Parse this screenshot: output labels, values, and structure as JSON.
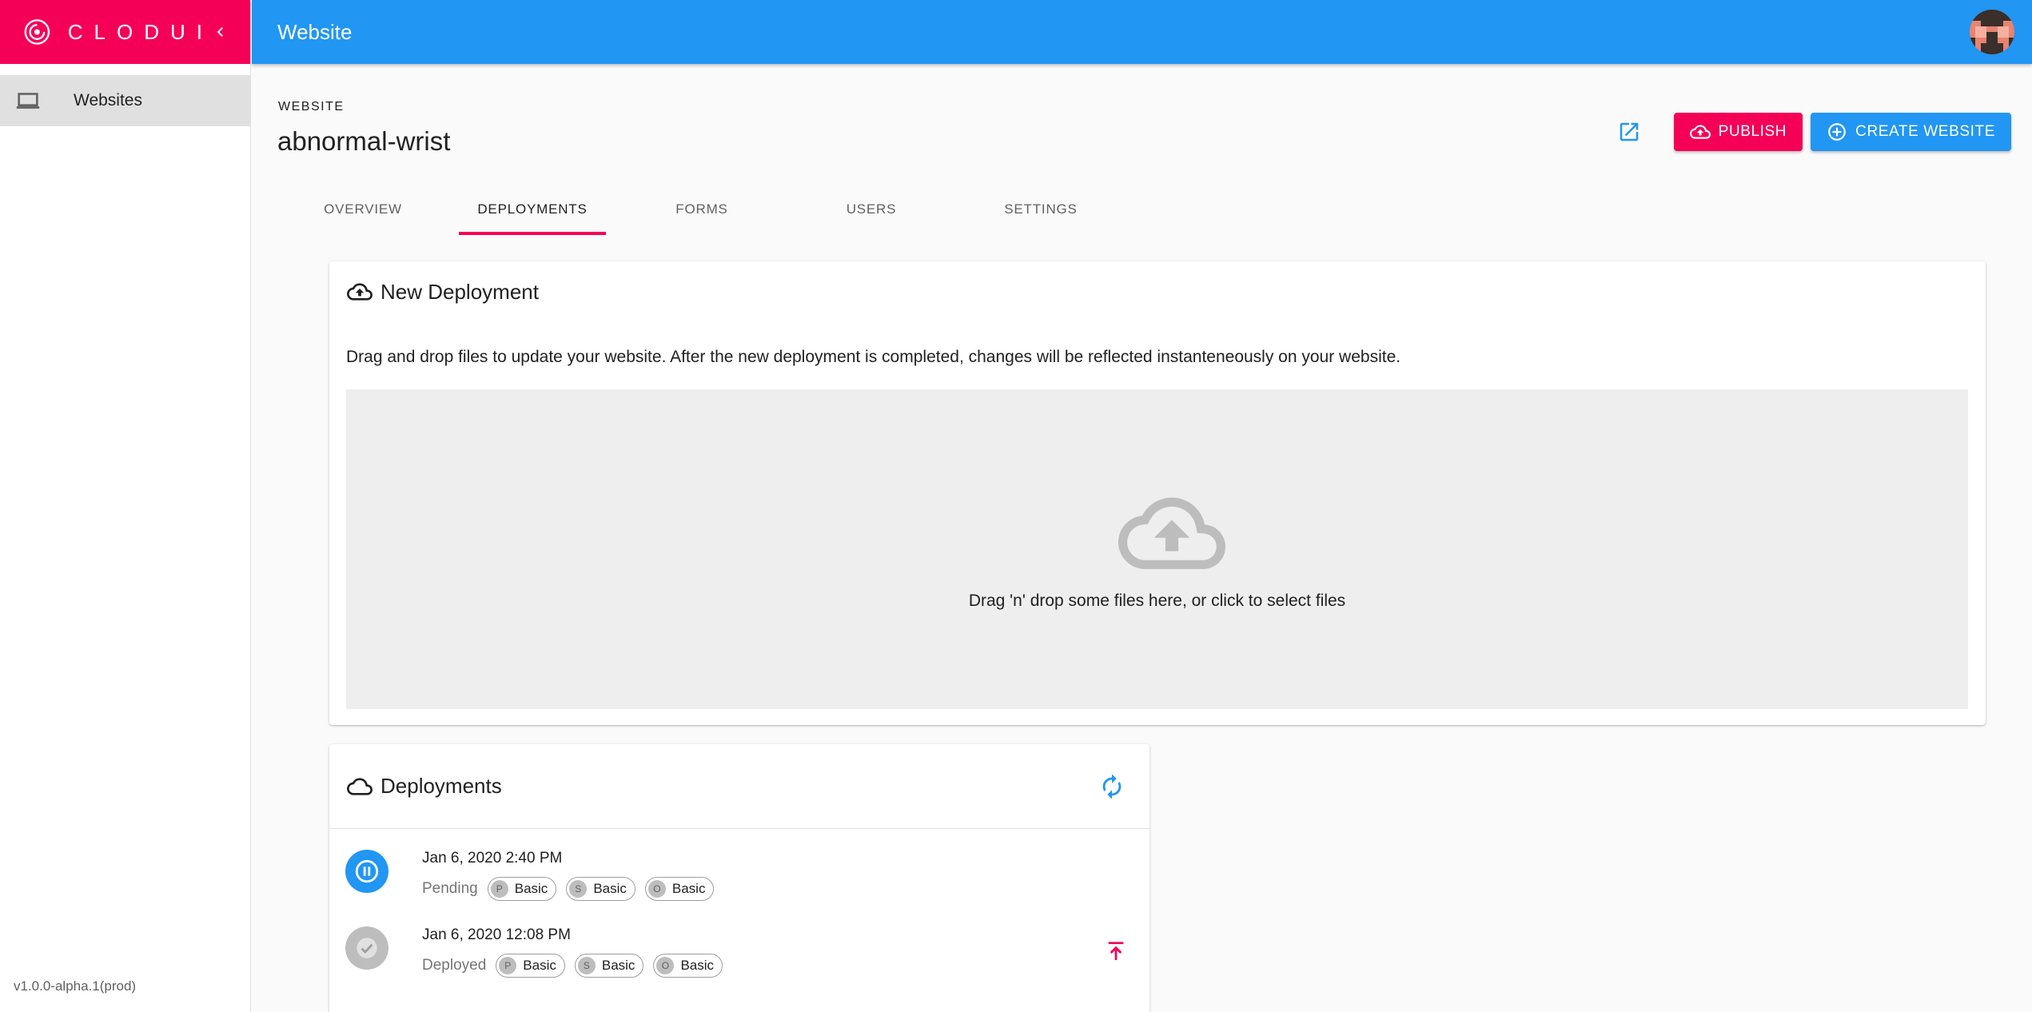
{
  "brand": {
    "name": "CLODUI",
    "color": "#f50057"
  },
  "sidebar": {
    "items": [
      {
        "label": "Websites",
        "icon": "laptop-icon"
      }
    ],
    "version": "v1.0.0-alpha.1(prod)"
  },
  "topbar": {
    "title": "Website",
    "color": "#2196f3"
  },
  "header": {
    "overline": "WEBSITE",
    "site_name": "abnormal-wrist",
    "publish_label": "PUBLISH",
    "create_label": "CREATE WEBSITE"
  },
  "tabs": [
    {
      "label": "OVERVIEW"
    },
    {
      "label": "DEPLOYMENTS",
      "active": true
    },
    {
      "label": "FORMS"
    },
    {
      "label": "USERS"
    },
    {
      "label": "SETTINGS"
    }
  ],
  "new_deployment": {
    "title": "New Deployment",
    "description": "Drag and drop files to update your website. After the new deployment is completed, changes will be reflected instanteneously on your website.",
    "dropzone_text": "Drag 'n' drop some files here, or click to select files"
  },
  "deployments": {
    "title": "Deployments",
    "items": [
      {
        "date": "Jan 6, 2020 2:40 PM",
        "status": "Pending",
        "status_icon": "pause-icon",
        "chips": [
          {
            "avatar": "P",
            "label": "Basic"
          },
          {
            "avatar": "S",
            "label": "Basic"
          },
          {
            "avatar": "O",
            "label": "Basic"
          }
        ]
      },
      {
        "date": "Jan 6, 2020 12:08 PM",
        "status": "Deployed",
        "status_icon": "check-icon",
        "chips": [
          {
            "avatar": "P",
            "label": "Basic"
          },
          {
            "avatar": "S",
            "label": "Basic"
          },
          {
            "avatar": "O",
            "label": "Basic"
          }
        ]
      }
    ]
  }
}
